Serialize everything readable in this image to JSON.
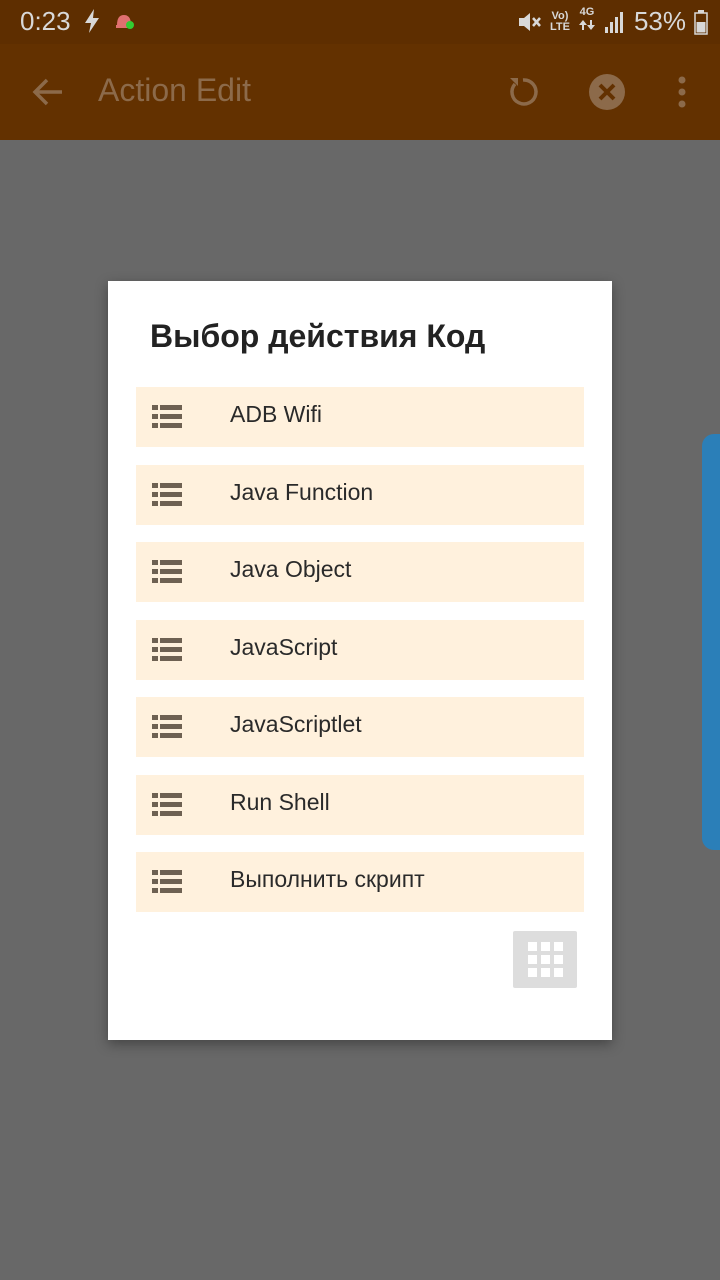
{
  "status_bar": {
    "time": "0:23",
    "battery": "53%",
    "volte_top": "Vo)",
    "volte_bottom": "LTE",
    "network": "4G"
  },
  "action_bar": {
    "title": "Action Edit"
  },
  "dialog": {
    "title": "Выбор действия Код",
    "items": [
      {
        "label": "ADB Wifi"
      },
      {
        "label": "Java Function"
      },
      {
        "label": "Java Object"
      },
      {
        "label": "JavaScript"
      },
      {
        "label": "JavaScriptlet"
      },
      {
        "label": "Run Shell"
      },
      {
        "label": "Выполнить скрипт"
      }
    ]
  },
  "colors": {
    "status_bar": "#5e2e00",
    "action_bar": "#633100",
    "overlay": "#686868",
    "item_background": "#fff1dd",
    "icon_brown": "#6e6152",
    "edge_handle": "#2b7fb8"
  },
  "icons": {
    "back": "arrow-left-icon",
    "reset": "reset-icon",
    "cancel": "close-circle-icon",
    "menu": "more-vert-icon",
    "item": "list-icon",
    "grid": "grid-icon"
  }
}
